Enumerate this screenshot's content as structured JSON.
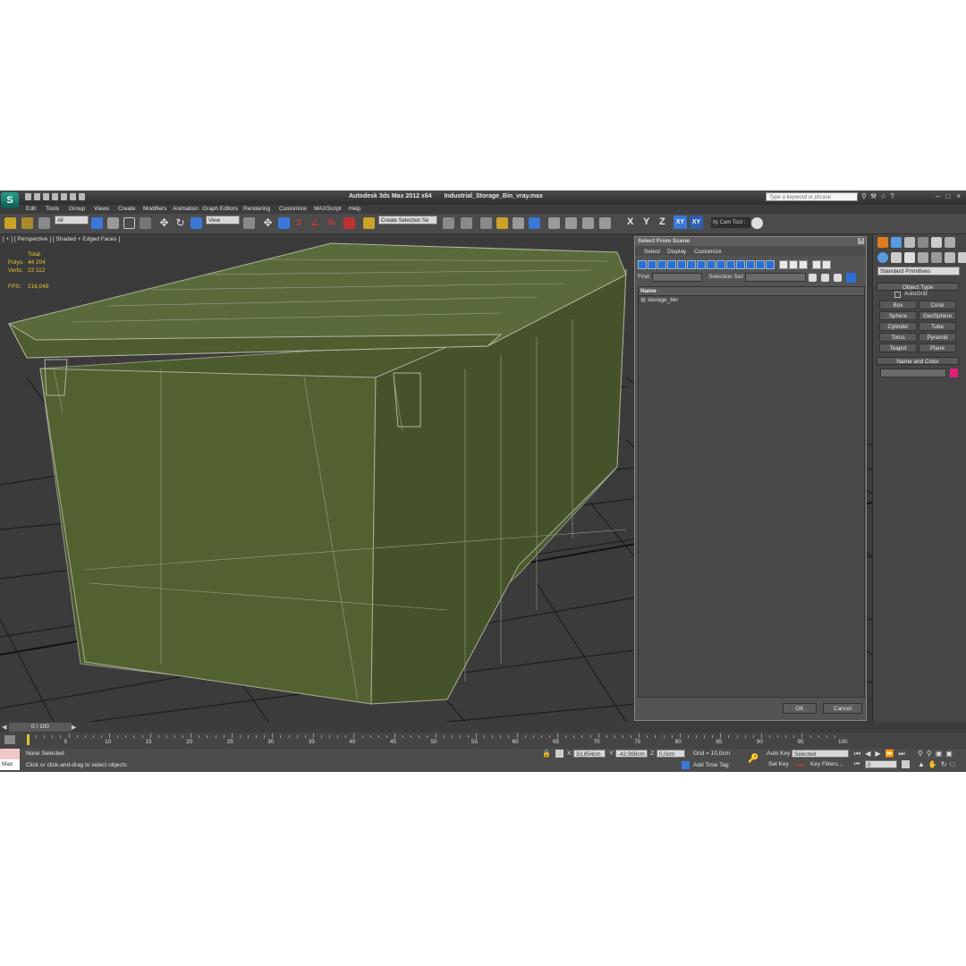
{
  "window": {
    "app_title": "Autodesk 3ds Max  2012 x64",
    "file_title": "Industrial_Storage_Bin_vray.max",
    "search_placeholder": "Type a keyword or phrase"
  },
  "menu": [
    "Edit",
    "Tools",
    "Group",
    "Views",
    "Create",
    "Modifiers",
    "Animation",
    "Graph Editors",
    "Rendering",
    "Customize",
    "MAXScript",
    "Help"
  ],
  "toolbar": {
    "filter_value": "All",
    "reference_coord": "View",
    "selection_set_placeholder": "Create Selection Se",
    "axes": [
      "X",
      "Y",
      "Z",
      "XY",
      "XY"
    ],
    "cam_tool": "ity Cam Tool :"
  },
  "viewport": {
    "label": "[ + ] [ Perspective ] [ Shaded + Edged Faces ]",
    "stats": {
      "header": "Total",
      "polys_label": "Polys:",
      "polys_value": "44 204",
      "verts_label": "Verts:",
      "verts_value": "22 112",
      "fps_label": "FPS:",
      "fps_value": "216,049"
    }
  },
  "select_from_scene": {
    "title": "Select From Scene",
    "menu": [
      "Select",
      "Display",
      "Customize"
    ],
    "find_label": "Find:",
    "selection_set_label": "Selection Set:",
    "column_name": "Name",
    "items": [
      "storage_bin"
    ],
    "ok_label": "OK",
    "cancel_label": "Cancel"
  },
  "command_panel": {
    "category": "Standard Primitives",
    "object_type_header": "Object Type",
    "autogrid_label": "AutoGrid",
    "object_buttons": [
      "Box",
      "Cone",
      "Sphere",
      "GeoSphere",
      "Cylinder",
      "Tube",
      "Torus",
      "Pyramid",
      "Teapot",
      "Plane"
    ],
    "name_color_header": "Name and Color",
    "swatch_color": "#e0207a"
  },
  "time": {
    "frame_display": "0 / 100",
    "ticks": [
      "0",
      "5",
      "10",
      "15",
      "20",
      "25",
      "30",
      "35",
      "40",
      "45",
      "50",
      "55",
      "60",
      "65",
      "70",
      "75",
      "80",
      "85",
      "90",
      "95",
      "100"
    ]
  },
  "status": {
    "selection": "None Selected",
    "prompt": "Click or click-and-drag to select objects",
    "x_label": "X:",
    "x_value": "33,854cm",
    "y_label": "Y:",
    "y_value": "-42,069cm",
    "z_label": "Z:",
    "z_value": "0,0cm",
    "grid": "Grid = 10,0cm",
    "add_time_tag": "Add Time Tag",
    "auto_key": "Auto Key",
    "set_key": "Set Key",
    "key_mode": "Selected",
    "key_filters": "Key Filters...",
    "current_frame": "0",
    "maxscript_label": "Max"
  },
  "colors": {
    "accent_blue": "#2b6fd6",
    "viewport_bg": "#3b3b3b",
    "stats_yellow": "#e0c431",
    "bin_green": "#4c5a2e"
  }
}
